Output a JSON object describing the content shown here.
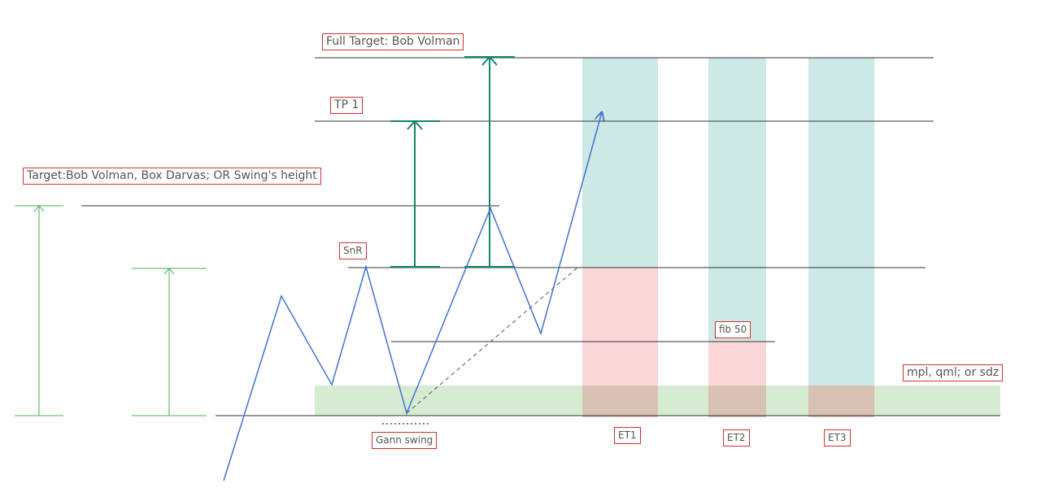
{
  "labels": {
    "full_target": "Full Target: Bob Volman",
    "tp1": "TP 1",
    "target": "Target:Bob Volman, Box Darvas; OR Swing's height",
    "snr": "SnR",
    "fib50": "fib 50",
    "mpl": "mpl, qml; or sdz",
    "gann": "Gann swing",
    "et1": "ET1",
    "et2": "ET2",
    "et3": "ET3"
  },
  "colors": {
    "price_line": "#3f72d4",
    "target_arrow": "#14866b",
    "swing_height_arrow": "#4caf50",
    "entry_zone_teal": "#cde9e5",
    "entry_zone_red": "#fbd6d9",
    "demand_zone_green": "#d5ebd2",
    "overlap_zone": "#d9c2b4",
    "label_border": "#d32f2f",
    "level_line": "#333333"
  }
}
